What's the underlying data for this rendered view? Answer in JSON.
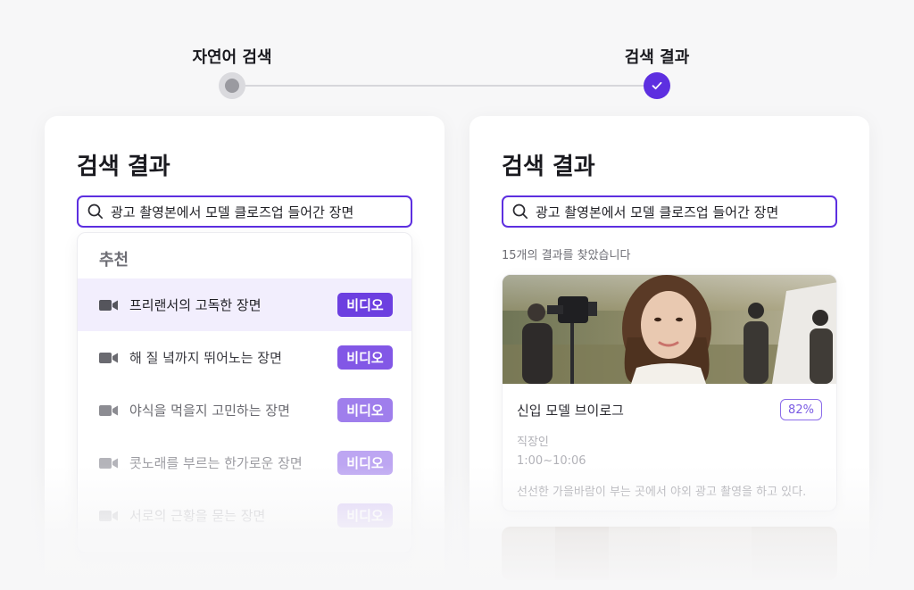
{
  "stepper": {
    "step1_label": "자연어 검색",
    "step2_label": "검색 결과"
  },
  "left_panel": {
    "title": "검색 결과",
    "search_value": "광고 촬영본에서 모델 클로즈업 들어간 장면",
    "dropdown": {
      "header": "추천",
      "items": [
        {
          "label": "프리랜서의 고독한 장면",
          "badge": "비디오"
        },
        {
          "label": "해 질 녘까지 뛰어노는 장면",
          "badge": "비디오"
        },
        {
          "label": "야식을 먹을지 고민하는 장면",
          "badge": "비디오"
        },
        {
          "label": "콧노래를 부르는 한가로운 장면",
          "badge": "비디오"
        },
        {
          "label": "서로의 근황을 묻는 장면",
          "badge": "비디오"
        }
      ]
    }
  },
  "right_panel": {
    "title": "검색 결과",
    "search_value": "광고 촬영본에서 모델 클로즈업 들어간 장면",
    "result_count": "15개의 결과를 찾았습니다",
    "cards": [
      {
        "title": "신입 모델 브이로그",
        "match": "82%",
        "category": "직장인",
        "time": "1:00~10:06",
        "description": "선선한 가을바람이 부는 곳에서 야외 광고 촬영을 하고 있다."
      }
    ]
  },
  "colors": {
    "accent": "#5d2fe0",
    "badge": "#7b4fe6",
    "active_row": "#f2eefd"
  }
}
